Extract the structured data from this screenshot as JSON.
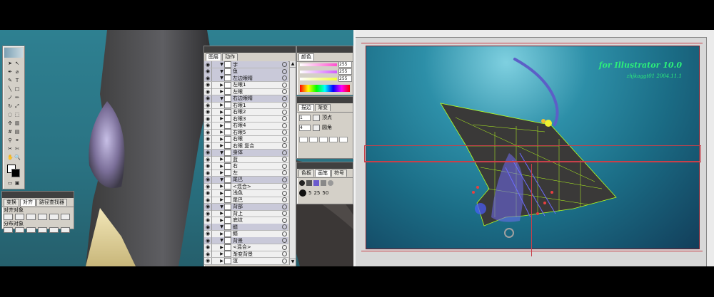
{
  "layers_panel": {
    "tabs": [
      "图层",
      "动作"
    ],
    "rows": [
      {
        "label": "字",
        "type": "group"
      },
      {
        "label": "鱼",
        "type": "group"
      },
      {
        "label": "左边眼睛",
        "type": "group"
      },
      {
        "label": "左眼1",
        "type": "item"
      },
      {
        "label": "左眼",
        "type": "item"
      },
      {
        "label": "右边眼睛",
        "type": "group"
      },
      {
        "label": "右眼1",
        "type": "item"
      },
      {
        "label": "右眼2",
        "type": "item"
      },
      {
        "label": "右眼3",
        "type": "item"
      },
      {
        "label": "右眼4",
        "type": "item"
      },
      {
        "label": "右眼5",
        "type": "item"
      },
      {
        "label": "右眼",
        "type": "item"
      },
      {
        "label": "右眼 复合",
        "type": "item"
      },
      {
        "label": "身体",
        "type": "group"
      },
      {
        "label": "蓝",
        "type": "item"
      },
      {
        "label": "右",
        "type": "item"
      },
      {
        "label": "左",
        "type": "item"
      },
      {
        "label": "尾巴",
        "type": "group"
      },
      {
        "label": "<混合>",
        "type": "item"
      },
      {
        "label": "浅色",
        "type": "item"
      },
      {
        "label": "尾巴",
        "type": "item"
      },
      {
        "label": "背部",
        "type": "group"
      },
      {
        "label": "背上",
        "type": "item"
      },
      {
        "label": "底纹",
        "type": "item"
      },
      {
        "label": "鳍",
        "type": "group"
      },
      {
        "label": "鳍",
        "type": "item"
      },
      {
        "label": "背景",
        "type": "group"
      },
      {
        "label": "<混合>",
        "type": "item"
      },
      {
        "label": "渐变背景",
        "type": "item"
      },
      {
        "label": "渲",
        "type": "item"
      }
    ]
  },
  "color_panel": {
    "tabs": [
      "颜色"
    ],
    "values": [
      "255",
      "255",
      "255"
    ]
  },
  "stroke_panel": {
    "tabs": [
      "描边",
      "渐变"
    ],
    "row1": {
      "label1": "1",
      "label2": "顶点"
    },
    "row2": {
      "label1": "4",
      "label2": "圆角"
    }
  },
  "brush_panel": {
    "tabs": [
      "色板",
      "画笔",
      "符号"
    ],
    "size_value": "5",
    "opacity_value": "25",
    "extra_value": "50"
  },
  "align_panel": {
    "tabs": [
      "变换",
      "对齐",
      "路径查找器"
    ],
    "label_align": "对齐对象",
    "label_distribute": "分布对象"
  },
  "artwork": {
    "title_line1": "for Illustrator 10.0",
    "title_line2": "zhjkaggt01 2004.11.1"
  },
  "colors": {
    "workspace_bg": "#2a7383",
    "panel_bg": "#d4d0c8",
    "mesh_green": "#b7ff1e",
    "mesh_blue": "#4a5cff",
    "guide_red": "#c8404a"
  }
}
